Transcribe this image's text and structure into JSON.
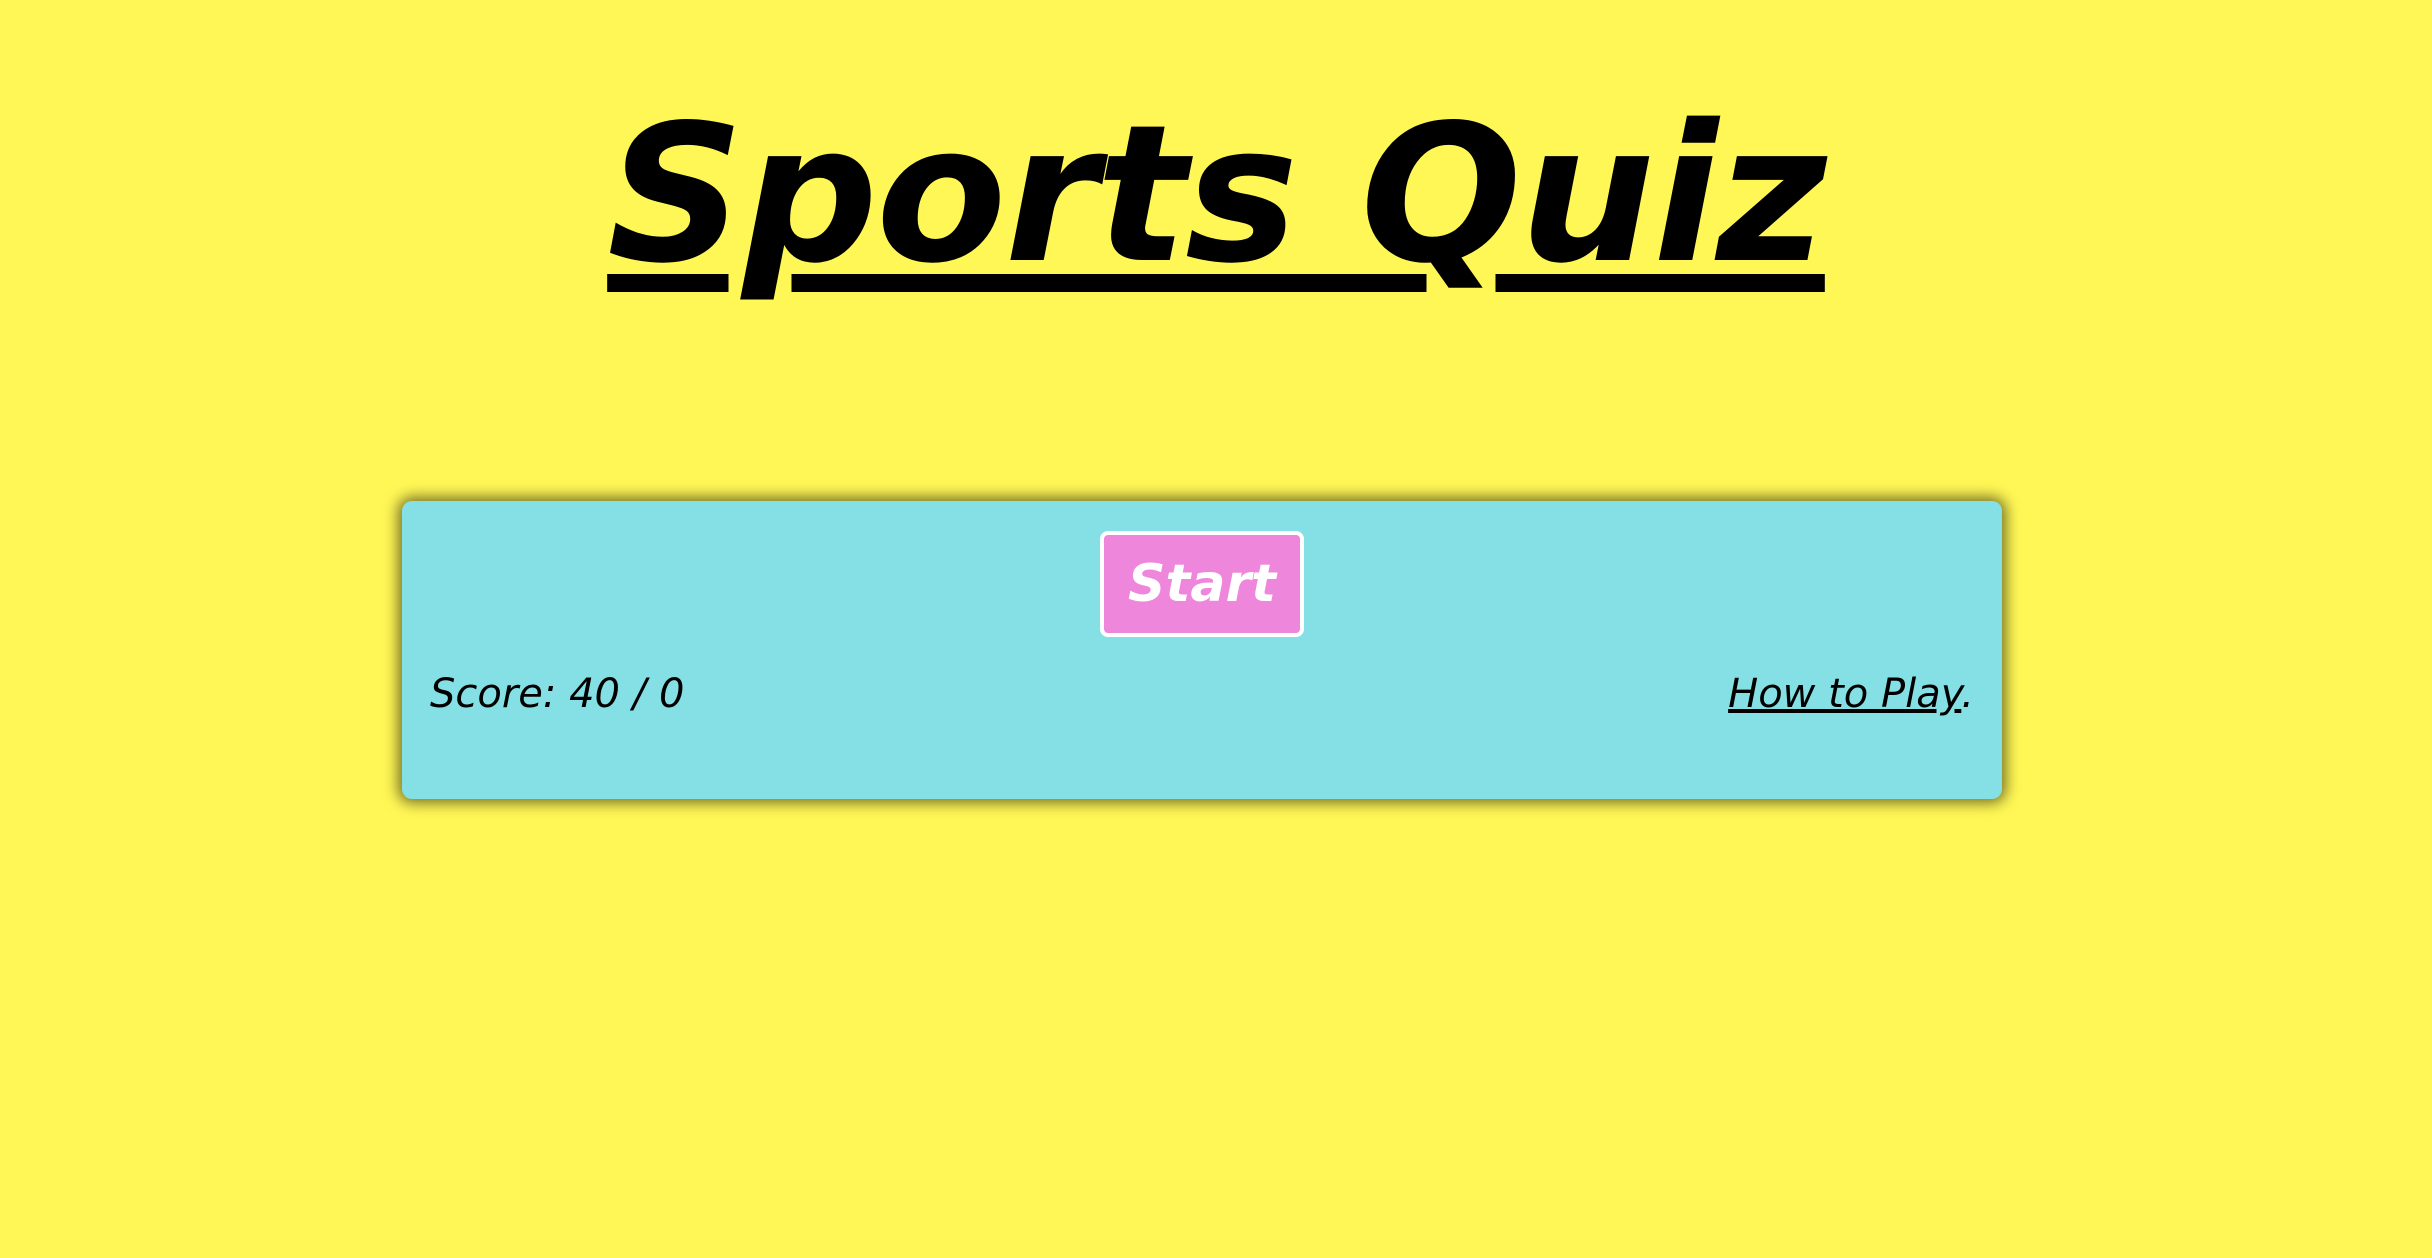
{
  "page": {
    "title": "Sports Quiz"
  },
  "quiz_panel": {
    "start_label": "Start",
    "score_label": "Score:",
    "score_correct": "40",
    "score_separator": "/",
    "score_total": "0",
    "how_to_play_label": "How to Play",
    "how_to_play_suffix": "."
  },
  "colors": {
    "background": "#fff755",
    "panel": "#84e0e5",
    "start_button": "#ee86dc",
    "start_button_border": "#ffffff",
    "text": "#000000"
  }
}
